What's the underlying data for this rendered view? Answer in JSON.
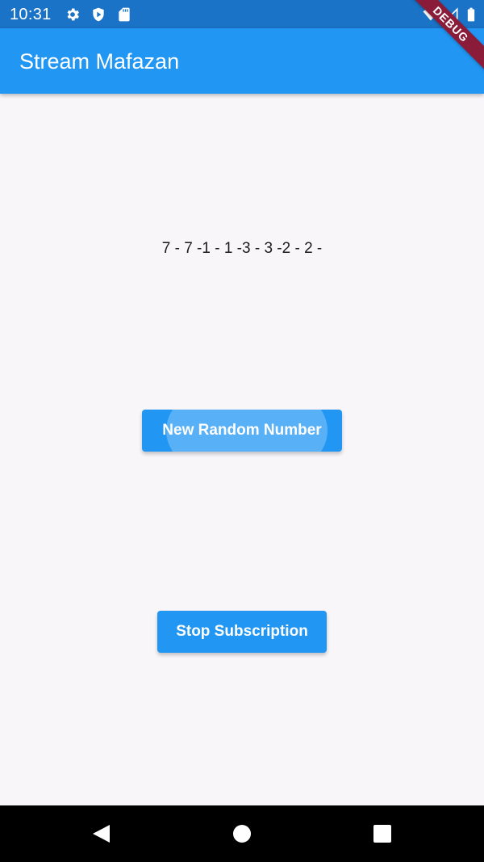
{
  "status_bar": {
    "time": "10:31",
    "icons": [
      "settings-icon",
      "shield-play-icon",
      "sd-card-icon",
      "wifi-icon",
      "signal-icon",
      "battery-icon"
    ]
  },
  "app_bar": {
    "title": "Stream Mafazan",
    "background_color": "#2196f3"
  },
  "debug_banner": {
    "label": "DEBUG",
    "color": "#8a1c3a"
  },
  "main": {
    "numbers_text": "7 - 7 -1 - 1 -3 - 3 -2 - 2 -",
    "new_random_button": "New Random Number",
    "stop_subscription_button": "Stop Subscription",
    "button_color": "#2196f3"
  },
  "nav_bar": {
    "icons": [
      "back-icon",
      "home-icon",
      "recents-icon"
    ]
  }
}
